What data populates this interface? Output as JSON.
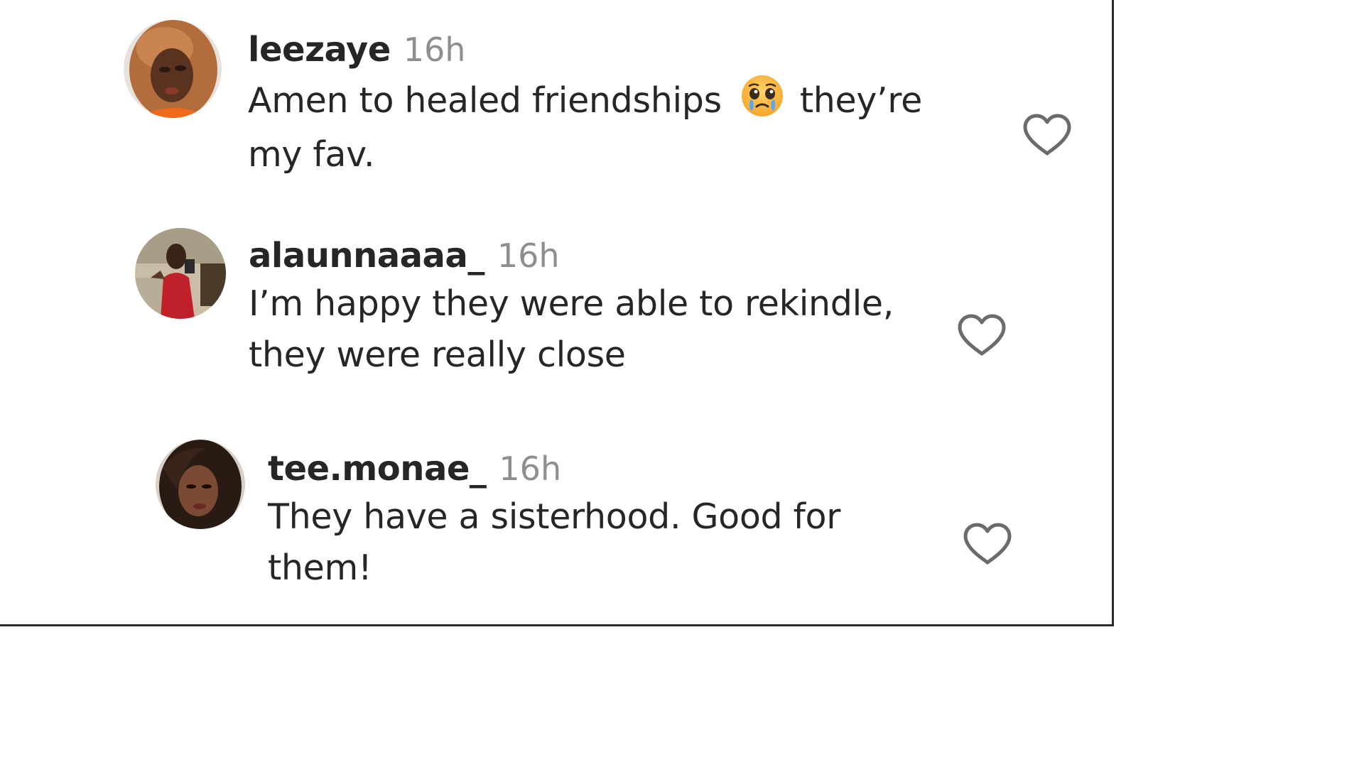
{
  "comments": [
    {
      "username": "leezaye",
      "time": "16h",
      "text_before": "Amen to healed friendships",
      "emoji": "crying-face-emoji",
      "text_after": "they’re",
      "text_line2": "my fav.",
      "like_icon": "heart-outline-icon"
    },
    {
      "username": "alaunnaaaa_",
      "time": "16h",
      "text_line1": "I’m happy they were able to rekindle,",
      "text_line2": "they were really close",
      "like_icon": "heart-outline-icon"
    },
    {
      "username": "tee.monae_",
      "time": "16h",
      "text_line1": "They have a sisterhood. Good for",
      "text_line2": "them!",
      "like_icon": "heart-outline-icon"
    }
  ],
  "colors": {
    "username": "#262626",
    "time": "#8e8e8e",
    "text": "#262626",
    "heart_stroke": "#6b6b6b"
  }
}
